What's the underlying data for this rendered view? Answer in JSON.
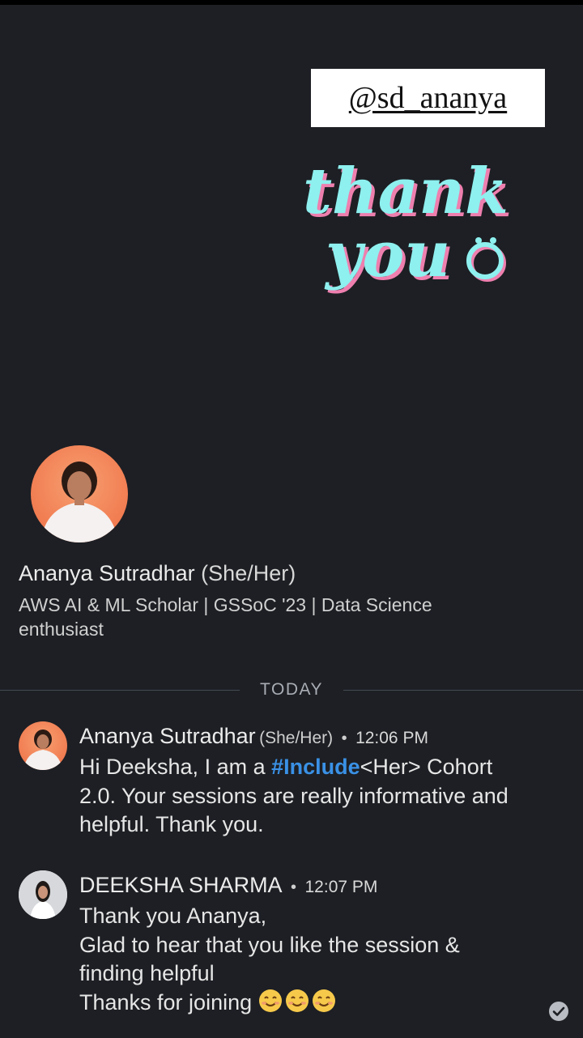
{
  "story": {
    "mention": "@sd_ananya",
    "sticker_line1": "thank",
    "sticker_line2": "you"
  },
  "profile": {
    "name": "Ananya Sutradhar",
    "pronouns": "(She/Her)",
    "headline": "AWS AI & ML Scholar | GSSoC '23 | Data Science enthusiast"
  },
  "divider": {
    "label": "TODAY"
  },
  "messages": [
    {
      "sender": "Ananya Sutradhar",
      "pronouns": "(She/Her)",
      "time": "12:06 PM",
      "text_before": "Hi Deeksha, I am a ",
      "hashtag": "#Include",
      "text_after": "<Her> Cohort 2.0. Your sessions are really informative and helpful. Thank you."
    },
    {
      "sender": "DEEKSHA SHARMA",
      "time": "12:07 PM",
      "lines": [
        "Thank you Ananya,",
        "Glad to hear that you like the session &",
        "finding helpful",
        "Thanks for joining"
      ],
      "emojis": [
        "smiling-face",
        "smiling-face",
        "smiling-face"
      ]
    }
  ],
  "colors": {
    "background": "#1d1f24",
    "hashtag": "#3a91e6",
    "sticker": "#8ef0ef",
    "sticker_shadow": "#ee7fae"
  }
}
